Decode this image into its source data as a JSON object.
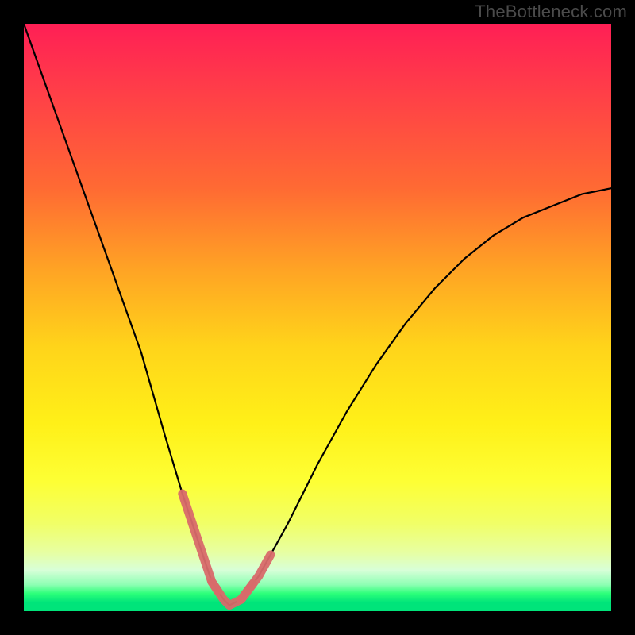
{
  "watermark": "TheBottleneck.com",
  "colors": {
    "frame": "#000000",
    "curve": "#000000",
    "highlight": "#d86a6a",
    "gradient_top": "#ff1f55",
    "gradient_mid": "#fff018",
    "gradient_bottom": "#00e47a"
  },
  "chart_data": {
    "type": "line",
    "title": "",
    "xlabel": "",
    "ylabel": "",
    "xlim": [
      0,
      100
    ],
    "ylim": [
      0,
      100
    ],
    "grid": false,
    "legend": false,
    "series": [
      {
        "name": "bottleneck-curve",
        "x": [
          0,
          5,
          10,
          15,
          20,
          24,
          27,
          30,
          32,
          34,
          35,
          37,
          40,
          45,
          50,
          55,
          60,
          65,
          70,
          75,
          80,
          85,
          90,
          95,
          100
        ],
        "y": [
          100,
          86,
          72,
          58,
          44,
          30,
          20,
          11,
          5,
          2,
          1,
          2,
          6,
          15,
          25,
          34,
          42,
          49,
          55,
          60,
          64,
          67,
          69,
          71,
          72
        ]
      }
    ],
    "annotations": [
      {
        "name": "optimal-range-highlight",
        "x_range": [
          27,
          42
        ],
        "y_range": [
          1,
          11
        ],
        "color": "#d86a6a"
      }
    ]
  }
}
